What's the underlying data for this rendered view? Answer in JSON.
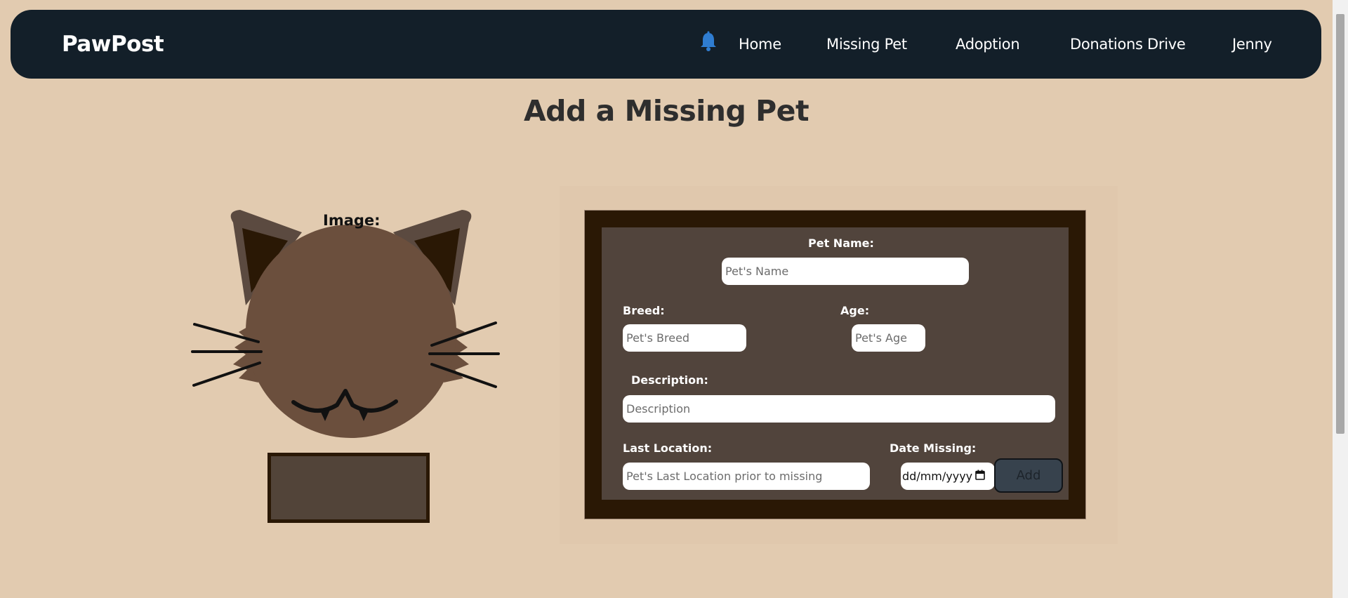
{
  "navbar": {
    "brand": "PawPost",
    "links": [
      "Home",
      "Missing Pet",
      "Adoption",
      "Donations Drive",
      "Jenny"
    ]
  },
  "page": {
    "title": "Add a Missing Pet"
  },
  "image_section": {
    "label": "Image:"
  },
  "form": {
    "pet_name": {
      "label": "Pet Name:",
      "placeholder": "Pet's Name"
    },
    "breed": {
      "label": "Breed:",
      "placeholder": "Pet's Breed"
    },
    "age": {
      "label": "Age:",
      "placeholder": "Pet's Age"
    },
    "description": {
      "label": "Description:",
      "placeholder": "Description"
    },
    "last_location": {
      "label": "Last Location:",
      "placeholder": "Pet's Last Location prior to missing"
    },
    "date_missing": {
      "label": "Date Missing:",
      "value": "dd/mm/yyyy"
    },
    "add_label": "Add"
  },
  "icons": {
    "bell": "bell-icon",
    "calendar": "calendar-icon"
  },
  "colors": {
    "navbar": "#131f29",
    "background": "#e2cbb0",
    "form_border": "#2a1805",
    "form_fill": "#51443c",
    "bell": "#2f7dd1",
    "cat_face": "#6b4f3d",
    "cat_ear_outer": "#5b4a40",
    "cat_ear_inner": "#2a1805"
  }
}
